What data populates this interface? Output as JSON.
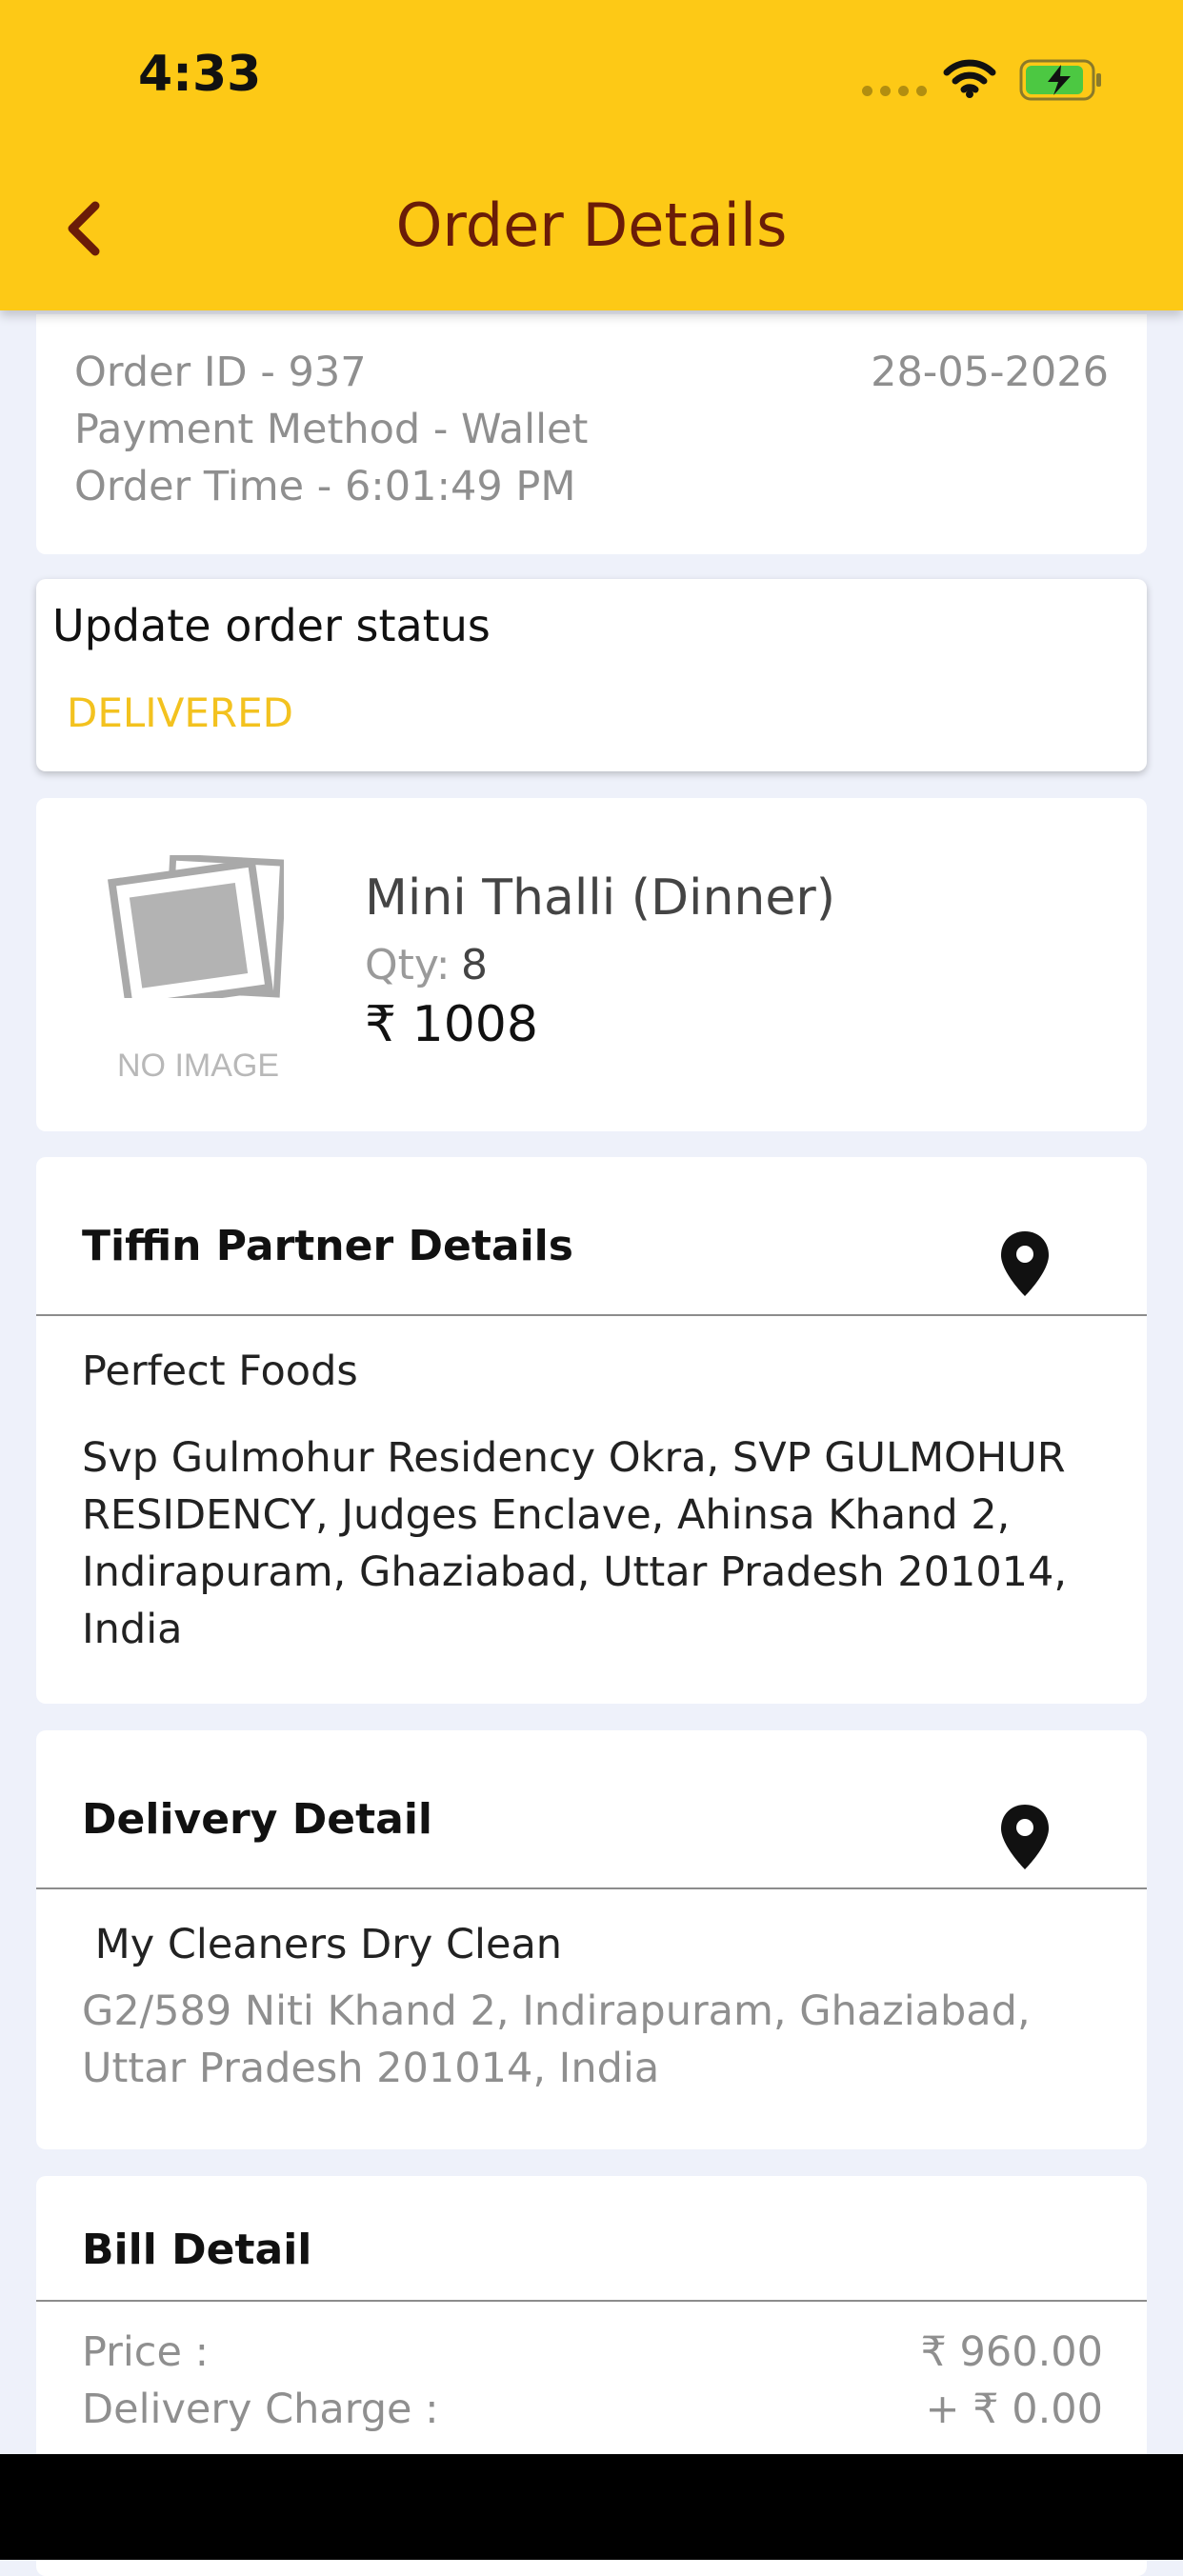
{
  "status_bar": {
    "time": "4:33"
  },
  "header": {
    "title": "Order Details",
    "back_icon": "chevron-left-icon"
  },
  "order": {
    "id_line": "Order ID - 937",
    "date": "28-05-2026",
    "payment_line": "Payment Method - Wallet",
    "time_line": "Order Time - 6:01:49 PM"
  },
  "status": {
    "title": "Update order status",
    "value": "DELIVERED"
  },
  "item": {
    "image_placeholder": "NO IMAGE",
    "name": "Mini Thalli (Dinner)",
    "qty_label": "Qty:",
    "qty_value": "8",
    "price": "₹ 1008"
  },
  "partner": {
    "heading": "Tiffin Partner Details",
    "name": "Perfect Foods",
    "address": "Svp Gulmohur Residency Okra, SVP GULMOHUR RESIDENCY, Judges Enclave, Ahinsa Khand 2, Indirapuram, Ghaziabad, Uttar Pradesh 201014, India",
    "icon": "map-pin-icon"
  },
  "delivery": {
    "heading": "Delivery Detail",
    "name": " My Cleaners Dry Clean",
    "address": "G2/589 Niti Khand 2, Indirapuram, Ghaziabad, Uttar Pradesh 201014, India",
    "icon": "map-pin-icon"
  },
  "bill": {
    "heading": "Bill Detail",
    "rows": [
      {
        "label": "Price :",
        "value": "₹ 960.00"
      },
      {
        "label": "Delivery Charge :",
        "value": "+ ₹ 0.00"
      }
    ]
  },
  "colors": {
    "header_bg": "#fdc916",
    "title_color": "#6a1c08",
    "status_color": "#f3c21f",
    "page_bg": "#eef1fa"
  }
}
